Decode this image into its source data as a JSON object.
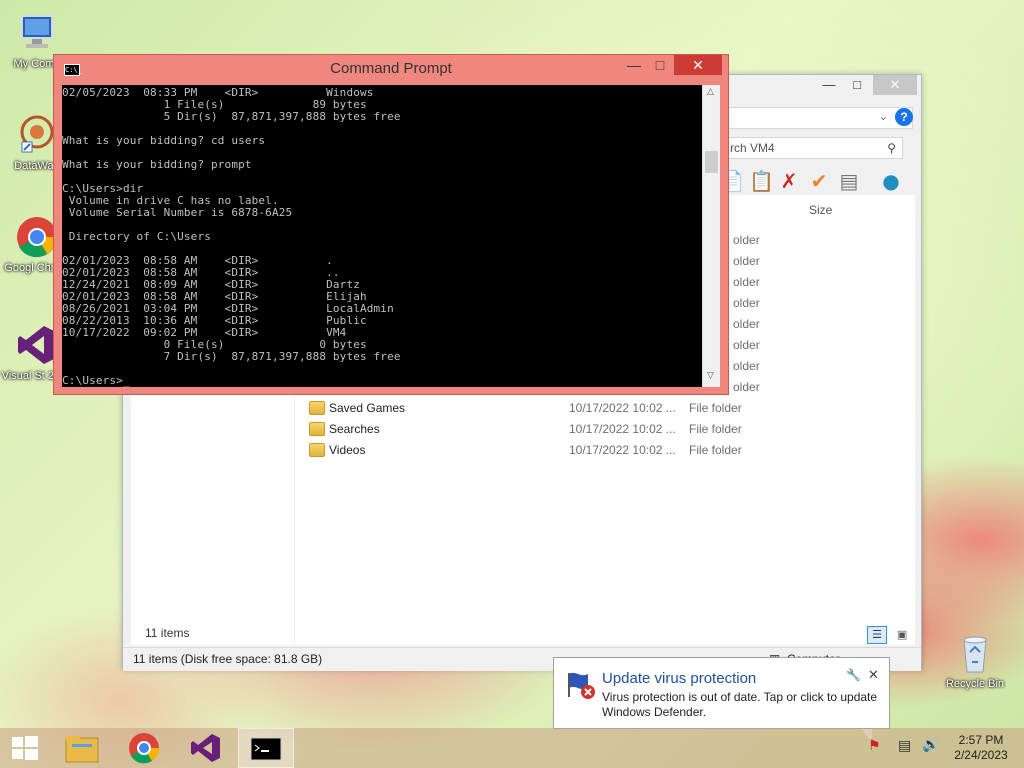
{
  "desktop": {
    "icons": [
      {
        "label": "My Comp",
        "name": "my-computer"
      },
      {
        "label": "DataWag",
        "name": "datawag"
      },
      {
        "label": "Googl Chrom",
        "name": "google-chrome"
      },
      {
        "label": "Visual St 2013",
        "name": "visual-studio"
      },
      {
        "label": "Recycle Bin",
        "name": "recycle-bin"
      }
    ]
  },
  "explorer": {
    "search_placeholder": "rch VM4",
    "column_size": "Size",
    "partial_types": [
      "older",
      "older",
      "older",
      "older",
      "older",
      "older",
      "older",
      "older"
    ],
    "rows": [
      {
        "name": "Saved Games",
        "date": "10/17/2022 10:02 ...",
        "type": "File folder"
      },
      {
        "name": "Searches",
        "date": "10/17/2022 10:02 ...",
        "type": "File folder"
      },
      {
        "name": "Videos",
        "date": "10/17/2022 10:02 ...",
        "type": "File folder"
      }
    ],
    "item_count": "11 items",
    "status_text": "11 items (Disk free space: 81.8 GB)",
    "status_location": "Computer"
  },
  "cmd": {
    "title": "Command Prompt",
    "icon_text": "C:\\_",
    "lines": [
      "02/05/2023  08:33 PM    <DIR>          Windows",
      "               1 File(s)             89 bytes",
      "               5 Dir(s)  87,871,397,888 bytes free",
      "",
      "What is your bidding? cd users",
      "",
      "What is your bidding? prompt",
      "",
      "C:\\Users>dir",
      " Volume in drive C has no label.",
      " Volume Serial Number is 6878-6A25",
      "",
      " Directory of C:\\Users",
      "",
      "02/01/2023  08:58 AM    <DIR>          .",
      "02/01/2023  08:58 AM    <DIR>          ..",
      "12/24/2021  08:09 AM    <DIR>          Dartz",
      "02/01/2023  08:58 AM    <DIR>          Elijah",
      "08/26/2021  03:04 PM    <DIR>          LocalAdmin",
      "08/22/2013  10:36 AM    <DIR>          Public",
      "10/17/2022  09:02 PM    <DIR>          VM4",
      "               0 File(s)              0 bytes",
      "               7 Dir(s)  87,871,397,888 bytes free",
      "",
      "C:\\Users>_"
    ]
  },
  "notification": {
    "title": "Update virus protection",
    "message": "Virus protection is out of date. Tap or click to update Windows Defender."
  },
  "taskbar": {
    "time": "2:57 PM",
    "date": "2/24/2023"
  },
  "colors": {
    "cmd_frame": "#ef877f",
    "cmd_close": "#cc3b34",
    "toast_title": "#1e4fa2"
  }
}
